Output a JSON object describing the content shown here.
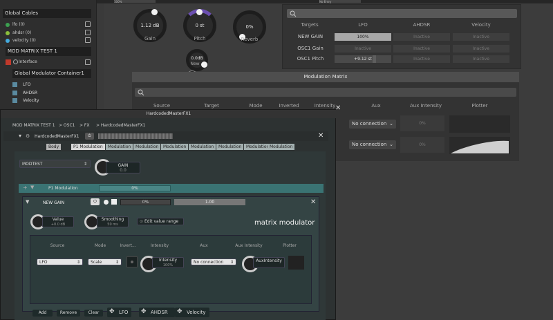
{
  "top": {
    "zoom_value": "100%",
    "right_dropdown": "No Entry"
  },
  "left": {
    "global_cables_title": "Global Cables",
    "cables": [
      {
        "name": "lfo (0)",
        "color": "#3ca050"
      },
      {
        "name": "ahdsr (0)",
        "color": "#8abf3c"
      },
      {
        "name": "velocity (0)",
        "color": "#44aadd"
      }
    ],
    "mod_matrix_title": "MOD MATRIX TEST 1",
    "interface_label": "Interface",
    "container_title": "Global Modulator Container1",
    "modulators": [
      "LFO",
      "AHDSR",
      "Velocity"
    ]
  },
  "knobs": [
    {
      "value": "1.12 dB",
      "label": "Gain"
    },
    {
      "value": "0 st",
      "label": "Pitch"
    },
    {
      "value": "0%",
      "label": "Reverb"
    },
    {
      "value": "0.0dB",
      "label": "New"
    }
  ],
  "targets": {
    "headers": [
      "Targets",
      "LFO",
      "AHDSR",
      "Velocity"
    ],
    "rows": [
      {
        "name": "NEW GAIN",
        "lfo": "100%",
        "ahdsr": "Inactive",
        "velocity": "Inactive"
      },
      {
        "name": "OSC1 Gain",
        "lfo": "Inactive",
        "ahdsr": "Inactive",
        "velocity": "Inactive"
      },
      {
        "name": "OSC1 Pitch",
        "lfo": "+9.12 st",
        "ahdsr": "Inactive",
        "velocity": "Inactive"
      }
    ]
  },
  "modmatrix": {
    "title": "Modulation Matrix",
    "headers": [
      "Source",
      "Target",
      "Mode",
      "Inverted",
      "Intensity",
      "Aux",
      "Aux Intensity",
      "Plotter"
    ],
    "rows": [
      {
        "aux": "No connection",
        "aux_intensity": "0%"
      },
      {
        "aux": "No connection",
        "aux_intensity": "0%"
      }
    ]
  },
  "fx": {
    "title": "HardcodedMasterFX1",
    "breadcrumb": [
      "MOD MATRIX TEST 1",
      ">  OSC1",
      ">  FX",
      ">  HardcodedMasterFX1"
    ],
    "module_name": "HardcodedMasterFX1",
    "tabs": [
      "Body",
      "P1 Modulation",
      "Modulation",
      "Modulation",
      "Modulation",
      "Modulation",
      "Modulation",
      "Modulation",
      "Modulation"
    ],
    "preset": "MODTEST",
    "gain_label": "GAIN",
    "gain_value": "0.0",
    "p1_label": "P1 Modulation",
    "p1_value": "0%",
    "new_gain": {
      "label": "NEW GAIN",
      "bar1": "0%",
      "bar2": "1.00"
    },
    "value_label": "Value",
    "value_value": "+0.0 dB",
    "smoothing_label": "Smoothing",
    "smoothing_value": "50 ms",
    "edit_range": "Edit value range",
    "brand": "matrix modulator",
    "inner_headers": [
      "Source",
      "Mode",
      "Invert...",
      "Intensity",
      "Aux",
      "Aux Intensity",
      "Plotter"
    ],
    "source": "LFO",
    "mode": "Scale",
    "intensity_label": "Intensity",
    "intensity_value": "100%",
    "aux": "No connection",
    "aux_intensity_label": "AuxIntensity",
    "buttons": [
      "Add",
      "Remove",
      "Clear"
    ],
    "sources": [
      "LFO",
      "AHDSR",
      "Velocity"
    ]
  }
}
